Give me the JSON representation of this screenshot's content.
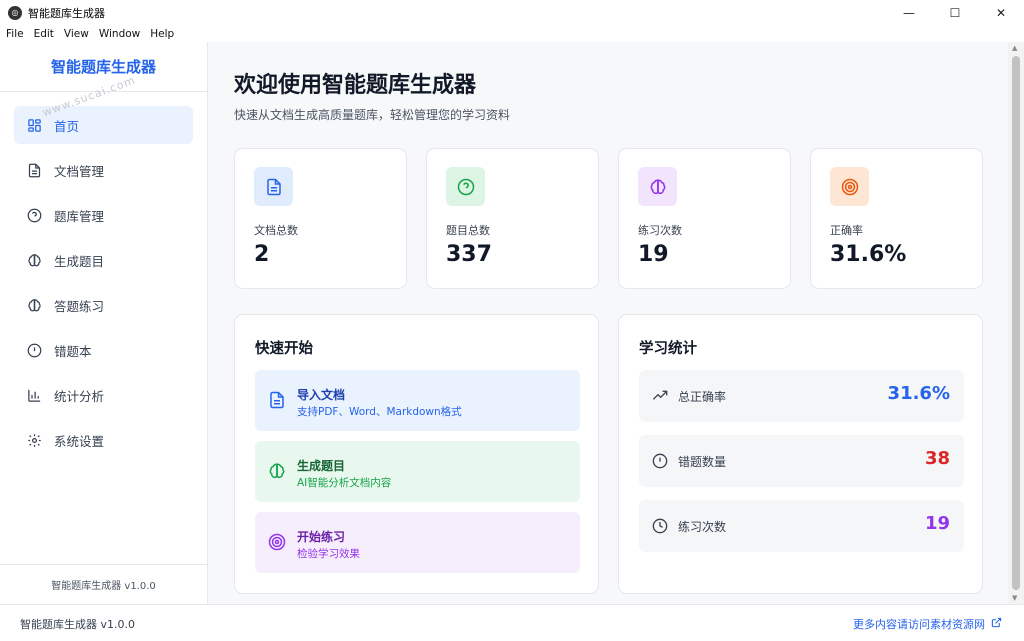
{
  "window": {
    "title": "智能题库生成器",
    "controls": {
      "minimize": "—",
      "maximize": "☐",
      "close": "✕"
    }
  },
  "menu": [
    "File",
    "Edit",
    "View",
    "Window",
    "Help"
  ],
  "sidebar": {
    "title": "智能题库生成器",
    "watermark": "www.sucai.com",
    "items": [
      {
        "label": "首页",
        "icon": "dashboard-icon",
        "active": true
      },
      {
        "label": "文档管理",
        "icon": "document-icon"
      },
      {
        "label": "题库管理",
        "icon": "question-circle-icon"
      },
      {
        "label": "生成题目",
        "icon": "brain-icon"
      },
      {
        "label": "答题练习",
        "icon": "brain-icon"
      },
      {
        "label": "错题本",
        "icon": "alert-circle-icon"
      },
      {
        "label": "统计分析",
        "icon": "bar-chart-icon"
      },
      {
        "label": "系统设置",
        "icon": "gear-icon"
      }
    ],
    "footer": "智能题库生成器 v1.0.0"
  },
  "main": {
    "title": "欢迎使用智能题库生成器",
    "subtitle": "快速从文档生成高质量题库，轻松管理您的学习资料",
    "stats": [
      {
        "label": "文档总数",
        "value": "2",
        "icon": "document-icon",
        "color": "#2563eb",
        "bg": "#e0ecfd"
      },
      {
        "label": "题目总数",
        "value": "337",
        "icon": "question-circle-icon",
        "color": "#16a34a",
        "bg": "#dcf5e4"
      },
      {
        "label": "练习次数",
        "value": "19",
        "icon": "brain-icon",
        "color": "#9333ea",
        "bg": "#f1e4fc"
      },
      {
        "label": "正确率",
        "value": "31.6%",
        "icon": "target-icon",
        "color": "#ea580c",
        "bg": "#fde6d3"
      }
    ],
    "quick_start": {
      "title": "快速开始",
      "items": [
        {
          "title": "导入文档",
          "desc": "支持PDF、Word、Markdown格式",
          "icon": "document-icon",
          "color": "#1e40af",
          "desc_color": "#2563eb",
          "bg": "#eaf2fd"
        },
        {
          "title": "生成题目",
          "desc": "AI智能分析文档内容",
          "icon": "brain-icon",
          "color": "#166534",
          "desc_color": "#16a34a",
          "bg": "#e9f8ee"
        },
        {
          "title": "开始练习",
          "desc": "检验学习效果",
          "icon": "target-icon",
          "color": "#6b21a8",
          "desc_color": "#9333ea",
          "bg": "#f6eefd"
        }
      ]
    },
    "learning_stats": {
      "title": "学习统计",
      "items": [
        {
          "label": "总正确率",
          "value": "31.6%",
          "icon": "trending-up-icon",
          "color": "#2563eb"
        },
        {
          "label": "错题数量",
          "value": "38",
          "icon": "alert-circle-icon",
          "color": "#dc2626"
        },
        {
          "label": "练习次数",
          "value": "19",
          "icon": "clock-icon",
          "color": "#9333ea"
        }
      ]
    }
  },
  "statusbar": {
    "left": "智能题库生成器 v1.0.0",
    "right": "更多内容请访问素材资源网"
  }
}
